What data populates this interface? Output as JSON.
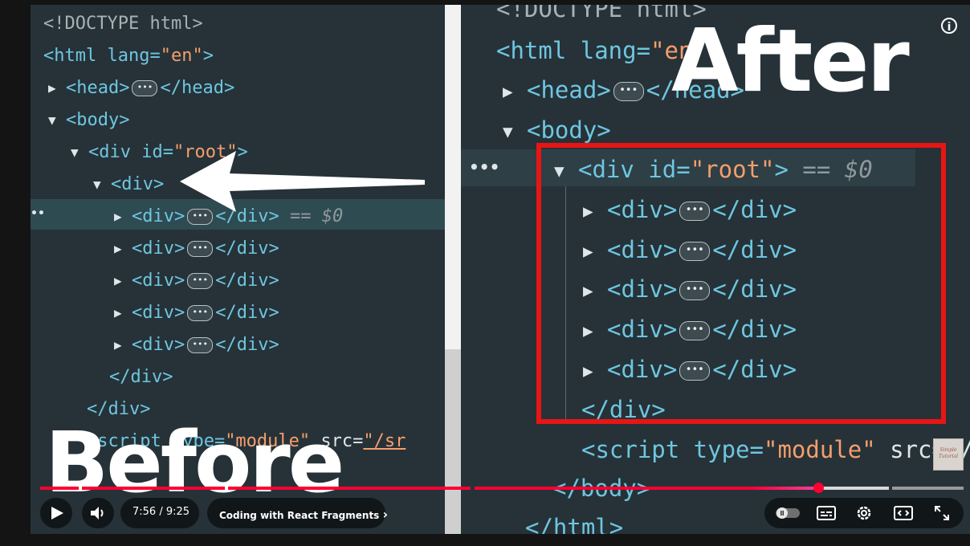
{
  "left_code": {
    "doctype": "<!DOCTYPE html>",
    "html_open": "<html lang=",
    "lang_value": "\"en\"",
    "html_close_bracket": ">",
    "head_open": "<head>",
    "head_close": "</head>",
    "body_open": "<body>",
    "root_div_open": "<div id=",
    "root_value": "\"root\"",
    "root_bracket": ">",
    "div_open": "<div>",
    "child_div_open": "<div>",
    "child_div_close": "</div>",
    "selected_marker": "== $0",
    "div_close": "</div>",
    "script_open": "<script type=",
    "script_type_value": "\"module\"",
    "script_src_attr": " src=",
    "script_src_value": "\"/sr",
    "ellipsis_pill": "•••",
    "row_dots": "••"
  },
  "right_code": {
    "doctype": "<!DOCTYPE html>",
    "html_open": "<html lang=",
    "lang_value": "\"en\"",
    "head_open": "<head>",
    "head_close": "</head>",
    "body_open": "<body>",
    "root_div_open": "<div id=",
    "root_value": "\"root\"",
    "root_bracket": ">",
    "selected_marker": "== $0",
    "child_div_open": "<div>",
    "child_div_close": "</div>",
    "div_close": "</div>",
    "script_open": "<script type=",
    "script_type_value": "\"module\"",
    "script_src_attr": " src=\"/",
    "body_close": "</body>",
    "html_close": "</html>",
    "ellipsis_pill": "•••",
    "row_dots": "•••"
  },
  "overlay": {
    "before_label": "Before",
    "after_label": "After",
    "info_glyph": "i",
    "watermark_text": "Simple Tutorial"
  },
  "player": {
    "current_time": "7:56",
    "duration": "9:25",
    "time_display": "7:56 / 9:25",
    "chapter_title": "Coding with React Fragments",
    "chapter_chevron": "›",
    "progress_fraction": 0.843,
    "colors": {
      "played": "#ff0033",
      "played_tail": "#ff3fa0",
      "buffered": "#d9d9d9",
      "unbuffered": "#9a9a9a",
      "highlight_box": "#e81515"
    },
    "icons": [
      "play-icon",
      "volume-icon",
      "autoplay-toggle-icon",
      "subtitles-icon",
      "settings-gear-icon",
      "miniplayer-icon",
      "fullscreen-icon",
      "info-icon"
    ]
  }
}
